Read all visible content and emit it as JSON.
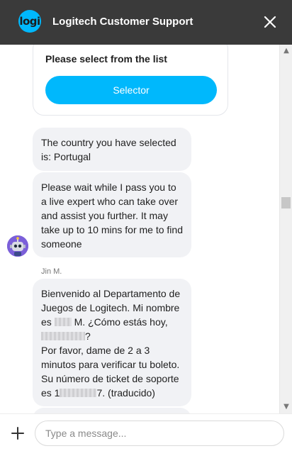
{
  "header": {
    "logo_text": "logi",
    "title": "Logitech Customer Support",
    "close_icon": "close-icon"
  },
  "card": {
    "title": "Please select from the list",
    "button_label": "Selector"
  },
  "messages": {
    "m1": "The country you have selected is: Portugal",
    "m2": "Please wait while I pass you to a live expert who can take over and assist you further. It may take up to 10 mins for me to find someone",
    "sender": "Jin M.",
    "m3_line1_pre": "Bienvenido al Departamento de Juegos de Logitech. Mi nombre es",
    "m3_line1_post": "M. ¿Cómo estás hoy,",
    "m3_line1_end": "?",
    "m3_line2": "Por favor, dame de 2 a 3 minutos para verificar tu boleto.",
    "m3_line3_pre": "Su número de ticket de soporte es 1",
    "m3_line3_post": "7. (traducido)"
  },
  "footer": {
    "placeholder": "Type a message...",
    "plus_icon": "plus-icon"
  },
  "colors": {
    "header_bg": "#3a3a3a",
    "accent": "#00b8fc",
    "bubble_bg": "#f1f2f5"
  }
}
